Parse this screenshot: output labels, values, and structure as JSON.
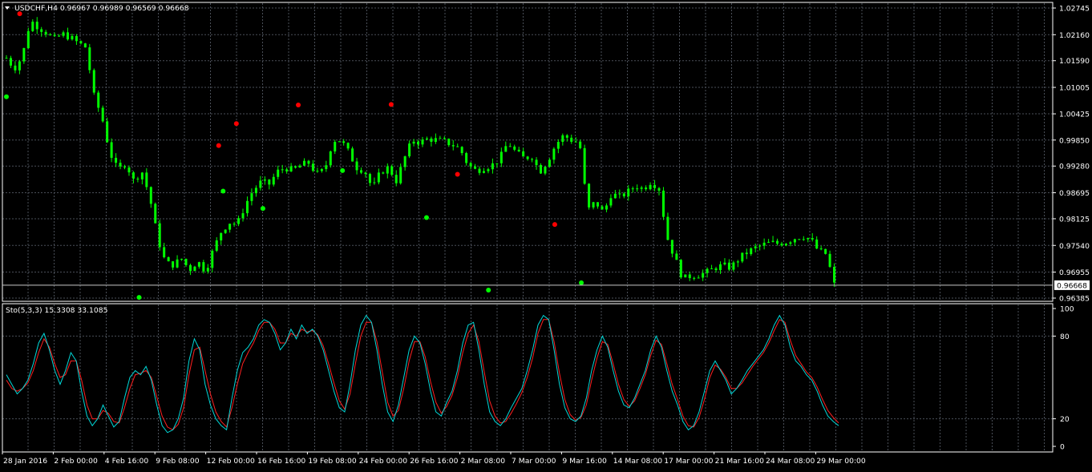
{
  "symbol_label": "USDCHF,H4",
  "ohlc": "0.96967 0.96989 0.96569 0.96668",
  "current_price": "0.96668",
  "colors": {
    "background": "#000000",
    "grid": "#4a4f58",
    "candle": "#00ff00",
    "fractal_up": "#ff0000",
    "fractal_down": "#00ff00",
    "stoch_main": "#00d8d8",
    "stoch_signal": "#ff2020",
    "frame": "#ffffff",
    "price_line": "#c8c8c8"
  },
  "chart_data": [
    {
      "type": "candlestick",
      "title": "USDCHF,H4",
      "y_ticks": [
        "1.02745",
        "1.02160",
        "1.01590",
        "1.01005",
        "1.00425",
        "0.99850",
        "0.99280",
        "0.98695",
        "0.98125",
        "0.97540",
        "0.96955",
        "0.96385"
      ],
      "ylim": [
        0.96385,
        1.02745
      ],
      "grid": true,
      "path": [
        [
          0,
          1.0165
        ],
        [
          1,
          1.0142
        ],
        [
          2,
          1.0168
        ],
        [
          3,
          1.0248
        ],
        [
          4,
          1.0233
        ],
        [
          5,
          1.0221
        ],
        [
          6,
          1.0205
        ],
        [
          7,
          1.0218
        ],
        [
          8,
          1.021
        ],
        [
          9,
          1.0198
        ],
        [
          10,
          1.0188
        ],
        [
          11,
          1.0082
        ],
        [
          12,
          1.0035
        ],
        [
          13,
          0.9958
        ],
        [
          14,
          0.9918
        ],
        [
          15,
          0.9935
        ],
        [
          16,
          0.9895
        ],
        [
          17,
          0.9918
        ],
        [
          18,
          0.986
        ],
        [
          19,
          0.977
        ],
        [
          20,
          0.9715
        ],
        [
          21,
          0.9712
        ],
        [
          22,
          0.9725
        ],
        [
          23,
          0.97
        ],
        [
          24,
          0.972
        ],
        [
          25,
          0.9698
        ],
        [
          26,
          0.9745
        ],
        [
          27,
          0.9785
        ],
        [
          28,
          0.9805
        ],
        [
          29,
          0.98
        ],
        [
          30,
          0.9843
        ],
        [
          31,
          0.9875
        ],
        [
          32,
          0.9893
        ],
        [
          33,
          0.9888
        ],
        [
          34,
          0.9915
        ],
        [
          35,
          0.9925
        ],
        [
          36,
          0.9918
        ],
        [
          37,
          0.993
        ],
        [
          38,
          0.9935
        ],
        [
          39,
          0.991
        ],
        [
          40,
          0.992
        ],
        [
          41,
          0.9985
        ],
        [
          42,
          0.9985
        ],
        [
          43,
          0.9958
        ],
        [
          44,
          0.9925
        ],
        [
          45,
          0.9918
        ],
        [
          46,
          0.9878
        ],
        [
          47,
          0.9915
        ],
        [
          48,
          0.9925
        ],
        [
          49,
          0.9895
        ],
        [
          50,
          0.9945
        ],
        [
          51,
          0.9985
        ],
        [
          52,
          0.998
        ],
        [
          53,
          0.9988
        ],
        [
          54,
          0.9985
        ],
        [
          55,
          0.9982
        ],
        [
          56,
          0.9975
        ],
        [
          57,
          0.9965
        ],
        [
          58,
          0.993
        ],
        [
          59,
          0.9918
        ],
        [
          60,
          0.9925
        ],
        [
          61,
          0.993
        ],
        [
          62,
          0.9945
        ],
        [
          63,
          0.998
        ],
        [
          64,
          0.9958
        ],
        [
          65,
          0.9945
        ],
        [
          66,
          0.995
        ],
        [
          67,
          0.9915
        ],
        [
          68,
          0.994
        ],
        [
          69,
          0.9975
        ],
        [
          70,
          0.9995
        ],
        [
          71,
          0.9985
        ],
        [
          72,
          0.998
        ],
        [
          73,
          0.983
        ],
        [
          74,
          0.985
        ],
        [
          75,
          0.9825
        ],
        [
          76,
          0.9868
        ],
        [
          77,
          0.986
        ],
        [
          78,
          0.987
        ],
        [
          79,
          0.9885
        ],
        [
          80,
          0.9878
        ],
        [
          81,
          0.9895
        ],
        [
          82,
          0.9878
        ],
        [
          83,
          0.9772
        ],
        [
          84,
          0.9725
        ],
        [
          85,
          0.968
        ],
        [
          86,
          0.9688
        ],
        [
          87,
          0.969
        ],
        [
          88,
          0.9695
        ],
        [
          89,
          0.9705
        ],
        [
          90,
          0.971
        ],
        [
          91,
          0.9705
        ],
        [
          92,
          0.9725
        ],
        [
          93,
          0.9738
        ],
        [
          94,
          0.9748
        ],
        [
          95,
          0.9755
        ],
        [
          96,
          0.976
        ],
        [
          97,
          0.9758
        ],
        [
          98,
          0.9762
        ],
        [
          99,
          0.977
        ],
        [
          100,
          0.9775
        ],
        [
          101,
          0.9768
        ],
        [
          102,
          0.9742
        ],
        [
          103,
          0.9735
        ],
        [
          104,
          0.9668
        ]
      ],
      "fractals_up": [
        [
          3,
          1.0262
        ],
        [
          48,
          0.9973
        ],
        [
          52,
          1.0021
        ],
        [
          66,
          1.0062
        ],
        [
          87,
          1.0063
        ],
        [
          102,
          0.991
        ],
        [
          124,
          0.98
        ]
      ],
      "fractals_down": [
        [
          0,
          1.008
        ],
        [
          30,
          0.964
        ],
        [
          49,
          0.9873
        ],
        [
          58,
          0.9835
        ],
        [
          76,
          0.9918
        ],
        [
          95,
          0.9815
        ],
        [
          109,
          0.9656
        ],
        [
          130,
          0.9672
        ]
      ]
    },
    {
      "type": "line",
      "title": "Sto(5,3,3) 15.3308 33.1085",
      "y_ticks": [
        "100",
        "80",
        "20",
        "0"
      ],
      "ylim": [
        0,
        100
      ],
      "grid": true,
      "series": [
        {
          "name": "main",
          "values": [
            52,
            45,
            38,
            42,
            48,
            60,
            75,
            82,
            70,
            55,
            45,
            55,
            68,
            62,
            40,
            22,
            15,
            20,
            30,
            22,
            14,
            18,
            35,
            50,
            55,
            52,
            58,
            48,
            30,
            15,
            10,
            12,
            20,
            35,
            62,
            78,
            70,
            45,
            30,
            20,
            15,
            12,
            35,
            55,
            68,
            72,
            78,
            88,
            92,
            90,
            82,
            70,
            75,
            85,
            78,
            88,
            82,
            85,
            80,
            70,
            55,
            40,
            28,
            25,
            45,
            70,
            88,
            95,
            90,
            70,
            45,
            25,
            18,
            30,
            50,
            70,
            80,
            75,
            60,
            40,
            25,
            22,
            32,
            40,
            55,
            75,
            88,
            90,
            70,
            45,
            25,
            18,
            15,
            20,
            28,
            35,
            42,
            55,
            70,
            88,
            95,
            92,
            70,
            45,
            28,
            20,
            18,
            22,
            35,
            55,
            70,
            80,
            72,
            55,
            40,
            30,
            28,
            35,
            45,
            55,
            70,
            80,
            72,
            55,
            40,
            30,
            18,
            12,
            15,
            25,
            40,
            55,
            62,
            55,
            48,
            38,
            42,
            48,
            55,
            60,
            65,
            70,
            78,
            88,
            95,
            88,
            72,
            62,
            58,
            52,
            48,
            40,
            30,
            22,
            18,
            15
          ]
        },
        {
          "name": "signal",
          "values": [
            48,
            42,
            40,
            42,
            46,
            55,
            68,
            78,
            72,
            60,
            50,
            52,
            62,
            62,
            48,
            30,
            20,
            20,
            26,
            24,
            18,
            17,
            28,
            42,
            52,
            53,
            55,
            50,
            36,
            22,
            14,
            12,
            16,
            28,
            52,
            70,
            72,
            55,
            38,
            25,
            18,
            14,
            28,
            45,
            60,
            68,
            75,
            84,
            90,
            90,
            85,
            75,
            75,
            82,
            80,
            85,
            83,
            84,
            81,
            73,
            60,
            46,
            33,
            27,
            38,
            60,
            80,
            90,
            90,
            76,
            54,
            32,
            22,
            26,
            42,
            62,
            76,
            76,
            65,
            47,
            32,
            24,
            29,
            37,
            50,
            68,
            82,
            88,
            76,
            54,
            33,
            22,
            17,
            18,
            24,
            31,
            39,
            50,
            64,
            82,
            92,
            92,
            76,
            53,
            34,
            23,
            19,
            21,
            30,
            48,
            64,
            76,
            74,
            60,
            45,
            34,
            29,
            33,
            42,
            52,
            66,
            77,
            74,
            60,
            45,
            34,
            22,
            15,
            14,
            21,
            34,
            50,
            59,
            56,
            50,
            42,
            42,
            46,
            52,
            58,
            63,
            68,
            75,
            84,
            92,
            90,
            77,
            66,
            60,
            54,
            50,
            43,
            34,
            26,
            21,
            17
          ]
        }
      ],
      "x_ticks": [
        "28 Jan 2016",
        "2 Feb 00:00",
        "4 Feb 16:00",
        "9 Feb 08:00",
        "12 Feb 00:00",
        "16 Feb 16:00",
        "19 Feb 08:00",
        "24 Feb 00:00",
        "26 Feb 16:00",
        "2 Mar 08:00",
        "7 Mar 00:00",
        "9 Mar 16:00",
        "14 Mar 08:00",
        "17 Mar 00:00",
        "21 Mar 16:00",
        "24 Mar 08:00",
        "29 Mar 00:00"
      ]
    }
  ]
}
